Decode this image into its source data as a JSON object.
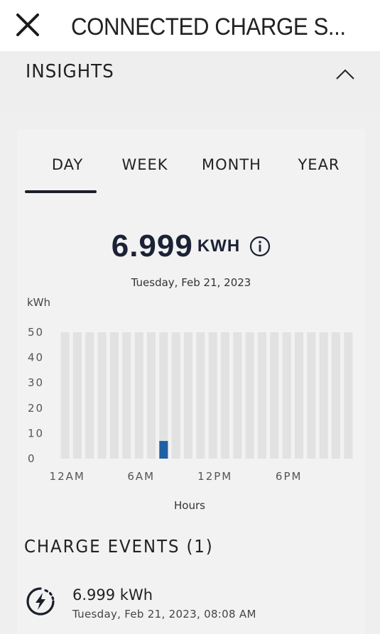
{
  "header": {
    "title": "CONNECTED CHARGE S...",
    "close_icon": "close-icon"
  },
  "insights": {
    "label": "INSIGHTS",
    "toggle_icon": "chevron-up-icon"
  },
  "tabs": [
    {
      "label": "DAY",
      "selected": true
    },
    {
      "label": "WEEK",
      "selected": false
    },
    {
      "label": "MONTH",
      "selected": false
    },
    {
      "label": "YEAR",
      "selected": false
    }
  ],
  "summary": {
    "value": "6.999",
    "unit": "KWH",
    "info_icon": "info-icon",
    "date": "Tuesday, Feb 21, 2023"
  },
  "colors": {
    "accent": "#1f5fa3",
    "bar_background": "#e2e2e2",
    "text_dark": "#1b2235"
  },
  "chart_data": {
    "type": "bar",
    "ylabel": "kWh",
    "xlabel": "Hours",
    "ylim": [
      0,
      50
    ],
    "yticks": [
      "50",
      "40",
      "30",
      "20",
      "10",
      "0"
    ],
    "xticks": [
      {
        "label": "12AM",
        "hour": 0
      },
      {
        "label": "6AM",
        "hour": 6
      },
      {
        "label": "12PM",
        "hour": 12
      },
      {
        "label": "6PM",
        "hour": 18
      }
    ],
    "categories": [
      0,
      1,
      2,
      3,
      4,
      5,
      6,
      7,
      8,
      9,
      10,
      11,
      12,
      13,
      14,
      15,
      16,
      17,
      18,
      19,
      20,
      21,
      22,
      23
    ],
    "values": [
      0,
      0,
      0,
      0,
      0,
      0,
      0,
      0,
      7,
      0,
      0,
      0,
      0,
      0,
      0,
      0,
      0,
      0,
      0,
      0,
      0,
      0,
      0,
      0
    ],
    "grid": false
  },
  "charge_events": {
    "title": "CHARGE EVENTS (1)",
    "items": [
      {
        "icon": "charge-bolt-icon",
        "energy": "6.999 kWh",
        "timestamp": "Tuesday, Feb 21, 2023, 08:08 AM"
      }
    ]
  }
}
